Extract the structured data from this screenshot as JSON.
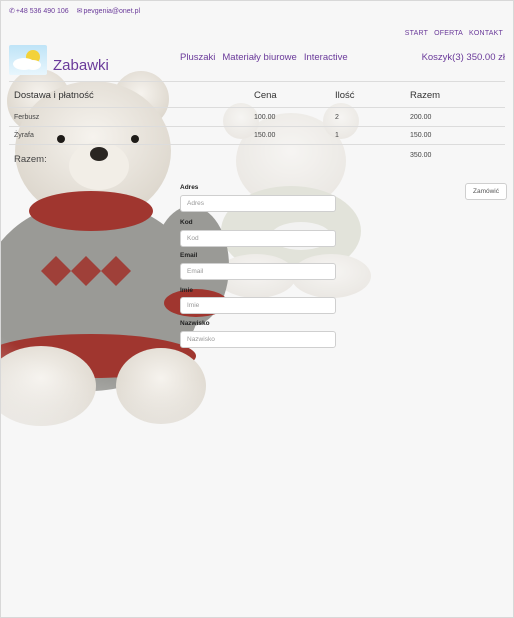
{
  "contact": {
    "phone": "+48 536 490 106",
    "email": "pevgenia@onet.pl"
  },
  "top_nav": [
    "START",
    "OFERTA",
    "KONTAKT"
  ],
  "brand": "Zabawki",
  "main_nav": [
    "Pluszaki",
    "Materiały biurowe",
    "Interactive"
  ],
  "cart": "Koszyk(3) 350.00 zł",
  "table": {
    "headers": [
      "Dostawa i płatność",
      "Cena",
      "Ilość",
      "Razem"
    ],
    "rows": [
      [
        "Ferbusz",
        "100.00",
        "2",
        "200.00"
      ],
      [
        "Żyrafa",
        "150.00",
        "1",
        "150.00"
      ]
    ],
    "total_label": "Razem:",
    "total_value": "350.00"
  },
  "order_button": "Zamówić",
  "form": [
    {
      "label": "Adres",
      "placeholder": "Adres"
    },
    {
      "label": "Kod",
      "placeholder": "Kod"
    },
    {
      "label": "Email",
      "placeholder": "Email"
    },
    {
      "label": "Imie",
      "placeholder": "Imie"
    },
    {
      "label": "Nazwisko",
      "placeholder": "Nazwisko"
    }
  ],
  "colors": {
    "accent": "#6a3a9a",
    "sweater_grey": "#9a9a96",
    "sweater_red": "#a0362f"
  },
  "icons": [
    "phone-icon",
    "mail-icon",
    "logo-sun-cloud"
  ]
}
